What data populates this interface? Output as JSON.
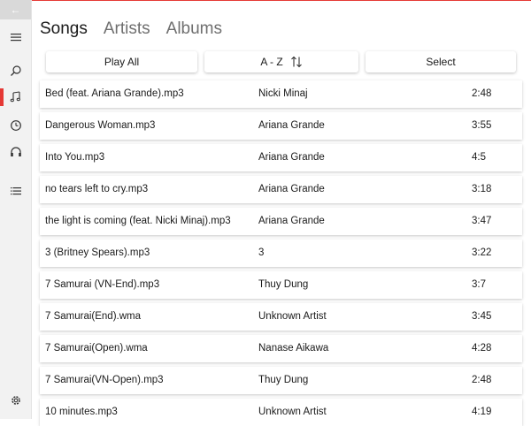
{
  "window": {
    "back_glyph": "←"
  },
  "sidebar": {
    "items": [
      {
        "name": "hamburger-icon"
      },
      {
        "name": "search-icon"
      },
      {
        "name": "music-note-icon"
      },
      {
        "name": "clock-icon"
      },
      {
        "name": "headphones-icon"
      },
      {
        "name": "list-icon"
      },
      {
        "name": "gear-icon"
      }
    ],
    "accent": "#e53935"
  },
  "tabs": [
    "Songs",
    "Artists",
    "Albums"
  ],
  "toolbar": {
    "play_all": "Play All",
    "sort": "A - Z",
    "select": "Select"
  },
  "songs": [
    {
      "title": "Bed (feat. Ariana Grande).mp3",
      "artist": "Nicki Minaj",
      "duration": "2:48"
    },
    {
      "title": "Dangerous Woman.mp3",
      "artist": "Ariana Grande",
      "duration": "3:55"
    },
    {
      "title": "Into You.mp3",
      "artist": "Ariana Grande",
      "duration": "4:5"
    },
    {
      "title": "no tears left to cry.mp3",
      "artist": "Ariana Grande",
      "duration": "3:18"
    },
    {
      "title": "the light is coming (feat. Nicki Minaj).mp3",
      "artist": "Ariana Grande",
      "duration": "3:47"
    },
    {
      "title": "3 (Britney Spears).mp3",
      "artist": "3",
      "duration": "3:22"
    },
    {
      "title": "7 Samurai (VN-End).mp3",
      "artist": "Thuy Dung",
      "duration": "3:7"
    },
    {
      "title": "7 Samurai(End).wma",
      "artist": "Unknown Artist",
      "duration": "3:45"
    },
    {
      "title": "7 Samurai(Open).wma",
      "artist": "Nanase Aikawa",
      "duration": "4:28"
    },
    {
      "title": "7 Samurai(VN-Open).mp3",
      "artist": "Thuy Dung",
      "duration": "2:48"
    },
    {
      "title": "10 minutes.mp3",
      "artist": "Unknown Artist",
      "duration": "4:19"
    }
  ]
}
